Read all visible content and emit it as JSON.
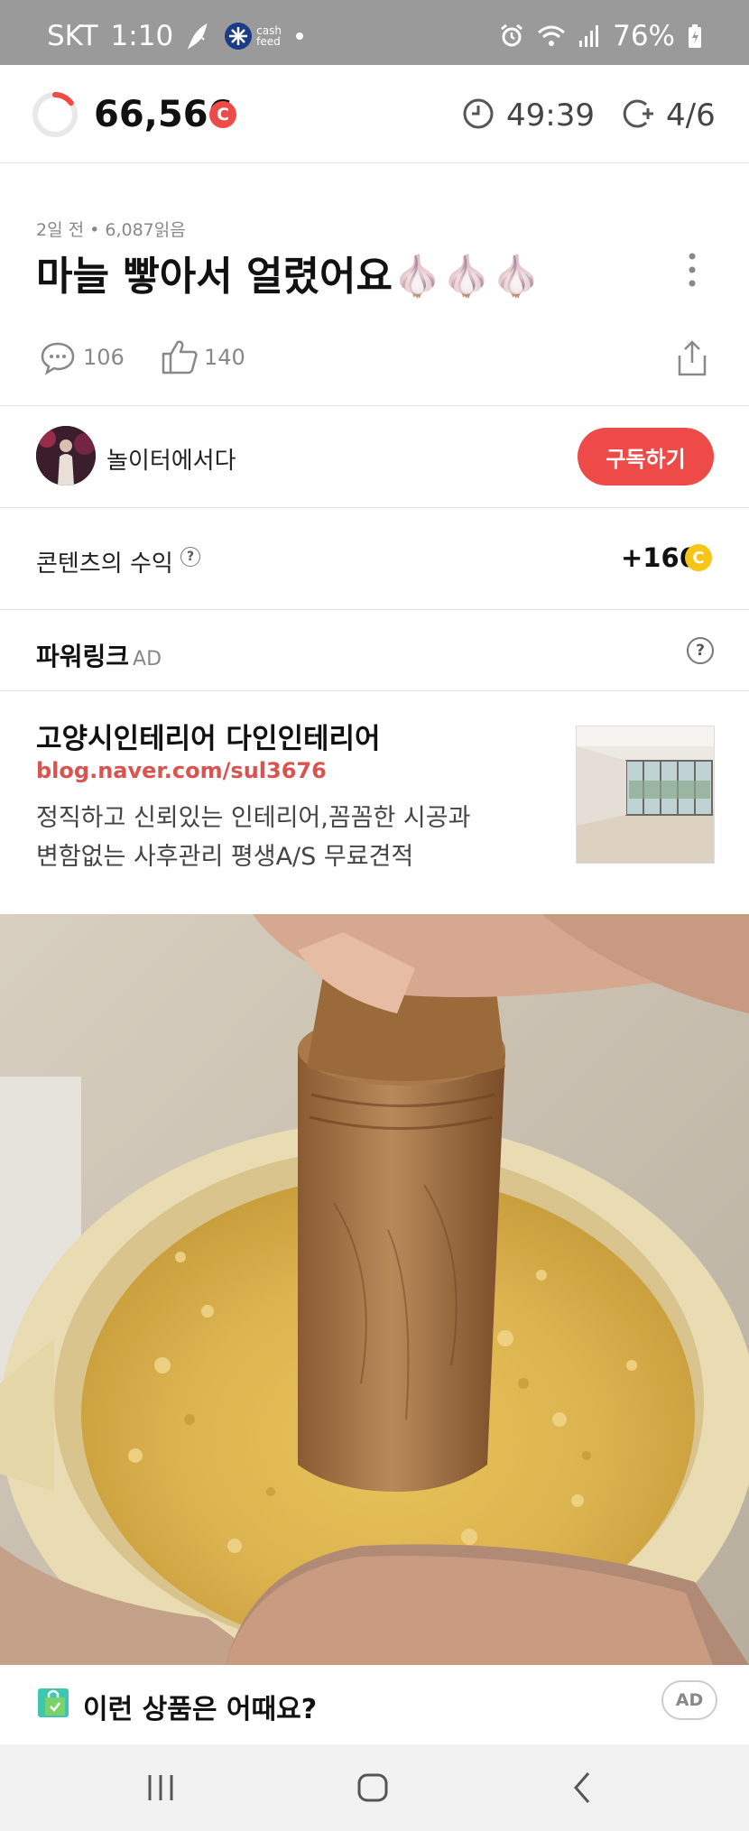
{
  "status_bar": {
    "carrier": "SKT",
    "time": "1:10",
    "cashfeed_label": "cash feed",
    "battery": "76%"
  },
  "header": {
    "points": "66,566",
    "points_badge": "C",
    "timer": "49:39",
    "quota": "4/6",
    "progress_ring_fraction": 0.15
  },
  "post": {
    "meta": "2일 전 • 6,087읽음",
    "title": "마늘 빻아서 얼렸어요🧄🧄🧄",
    "comments": "106",
    "likes": "140"
  },
  "author": {
    "name": "놀이터에서다",
    "subscribe_label": "구독하기"
  },
  "income": {
    "label": "콘텐츠의 수익",
    "help": "?",
    "value": "+166",
    "coin": "C"
  },
  "powerlink": {
    "label": "파워링크",
    "ad_tag": "AD",
    "help": "?",
    "ad": {
      "title": "고양시인테리어 다인인테리어",
      "url": "blog.naver.com/sul3676",
      "desc_line1": "정직하고 신뢰있는 인테리어,꼼꼼한 시공과",
      "desc_line2": "변함없는 사후관리 평생A/S 무료견적"
    }
  },
  "recommend": {
    "label": "이런 상품은 어때요?",
    "ad_tag": "AD"
  },
  "icons": {
    "accent": "#ee4a47",
    "coin": "#f5c518"
  }
}
